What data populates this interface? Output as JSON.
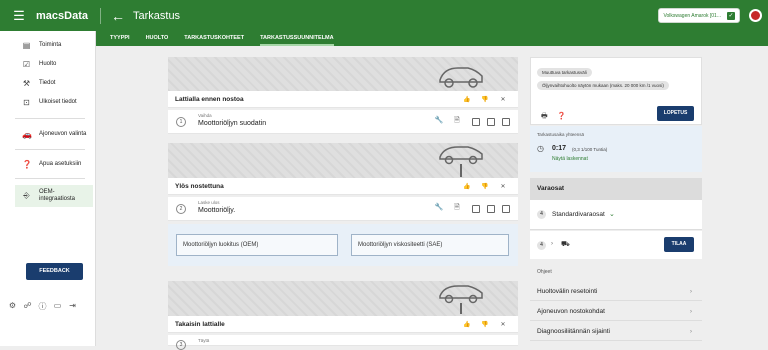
{
  "header": {
    "app_name": "macsData",
    "page_title": "Tarkastus",
    "vehicle": "Volkswagen Amarok [01..."
  },
  "subnav": [
    "TYYPPI",
    "HUOLTO",
    "TARKASTUSKOHTEET",
    "TARKASTUSSUUNNITELMA"
  ],
  "sidebar": {
    "items": [
      {
        "label": "Toiminta",
        "icon": "document-icon"
      },
      {
        "label": "Huolto",
        "icon": "checkbox-icon"
      },
      {
        "label": "Tiedot",
        "icon": "wrench-icon"
      },
      {
        "label": "Ulkoiset tiedot",
        "icon": "external-icon"
      },
      {
        "label": "Ajoneuvon valinta",
        "icon": "car-icon"
      },
      {
        "label": "Apua asetuksiin",
        "icon": "help-icon"
      },
      {
        "label": "OEM-integraatiosta",
        "icon": "oem-icon"
      }
    ],
    "feedback": "FEEDBACK"
  },
  "sections": [
    {
      "title": "Lattialla ennen nostoa",
      "row": {
        "num": "1",
        "small": "Vaihda",
        "text": "Moottoriöljyn suodatin"
      }
    },
    {
      "title": "Ylös nostettuna",
      "row": {
        "num": "2",
        "small": "Laske ulos",
        "text": "Moottoriöljy."
      }
    },
    {
      "title": "Takaisin lattialle",
      "row": {
        "num": "3",
        "small": "Täytä",
        "text": ""
      }
    }
  ],
  "fields": {
    "oil_grade": "Moottoriöljyn luokitus (OEM)",
    "oil_viscosity": "Moottoriöljyn viskositeetti (SAE)"
  },
  "right_panel": {
    "chip1": "Muuttuva tarkastusväli",
    "chip2": "Öljynvaihtohuolto näytön mukaan (maks. 20 000 km /1 vuosi)",
    "stop_button": "LOPETUS",
    "total_time_label": "Tarkastusaika yhteensä",
    "time": "0:17",
    "time_detail": "(0,3 1/100 Tuntia)",
    "show_calc": "Näytä laskennat",
    "parts_title": "Varaosat",
    "parts_count": "4",
    "parts_label": "Standardivaraosat",
    "order_count": "4",
    "order_button": "TILAA",
    "instructions_title": "Ohjeet",
    "instructions": [
      "Huoltovälin resetointi",
      "Ajoneuvon nostokohdat",
      "Diagnoosiliitännän sijainti"
    ]
  }
}
